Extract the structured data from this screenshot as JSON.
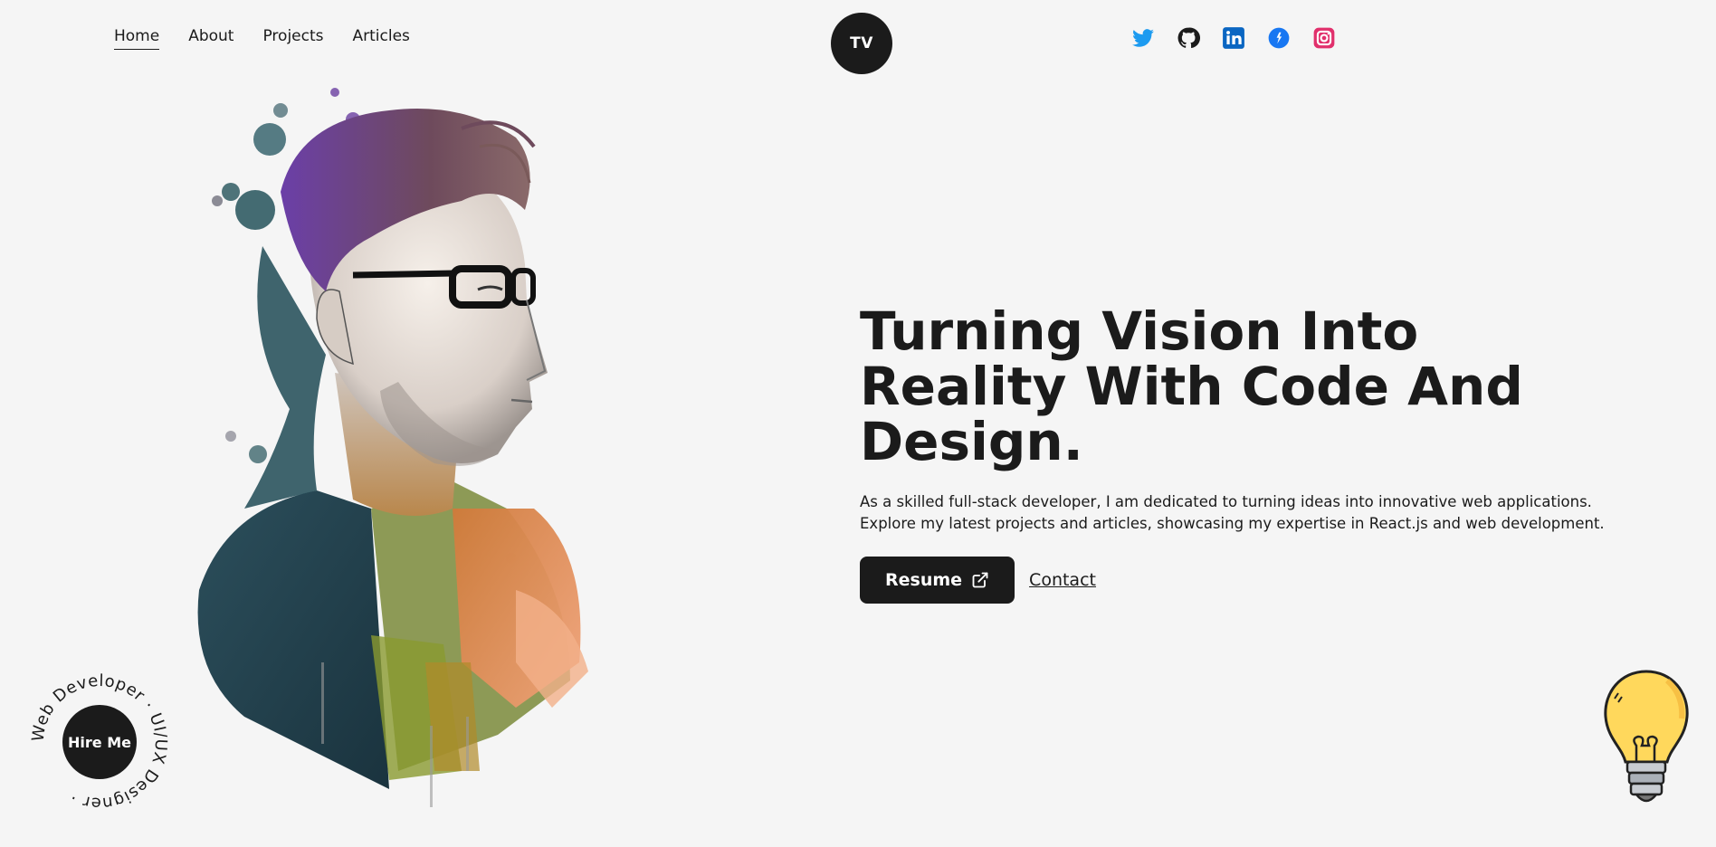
{
  "nav": {
    "links": [
      {
        "label": "Home",
        "active": true
      },
      {
        "label": "About"
      },
      {
        "label": "Projects"
      },
      {
        "label": "Articles"
      }
    ],
    "logo_text": "TV",
    "socials": [
      {
        "icon": "twitter-icon",
        "color": "#1d9bf0"
      },
      {
        "icon": "github-icon",
        "color": "#1b1b1b"
      },
      {
        "icon": "linkedin-icon",
        "color": "#0a66c2"
      },
      {
        "icon": "info-icon",
        "color": "#1877f2"
      },
      {
        "icon": "instagram-icon",
        "color": "#e1306c"
      }
    ]
  },
  "hero": {
    "headline": "Turning Vision Into Reality With Code And Design.",
    "description": "As a skilled full-stack developer, I am dedicated to turning ideas into innovative web applications. Explore my latest projects and articles, showcasing my expertise in React.js and web development.",
    "resume_label": "Resume",
    "contact_label": "Contact"
  },
  "hire": {
    "button_label": "Hire Me",
    "ring_text": "Web Developer · UI/UX Designer · "
  },
  "colors": {
    "background": "#f5f5f5",
    "dark": "#1b1b1b",
    "bulb": "#ffd85c"
  }
}
